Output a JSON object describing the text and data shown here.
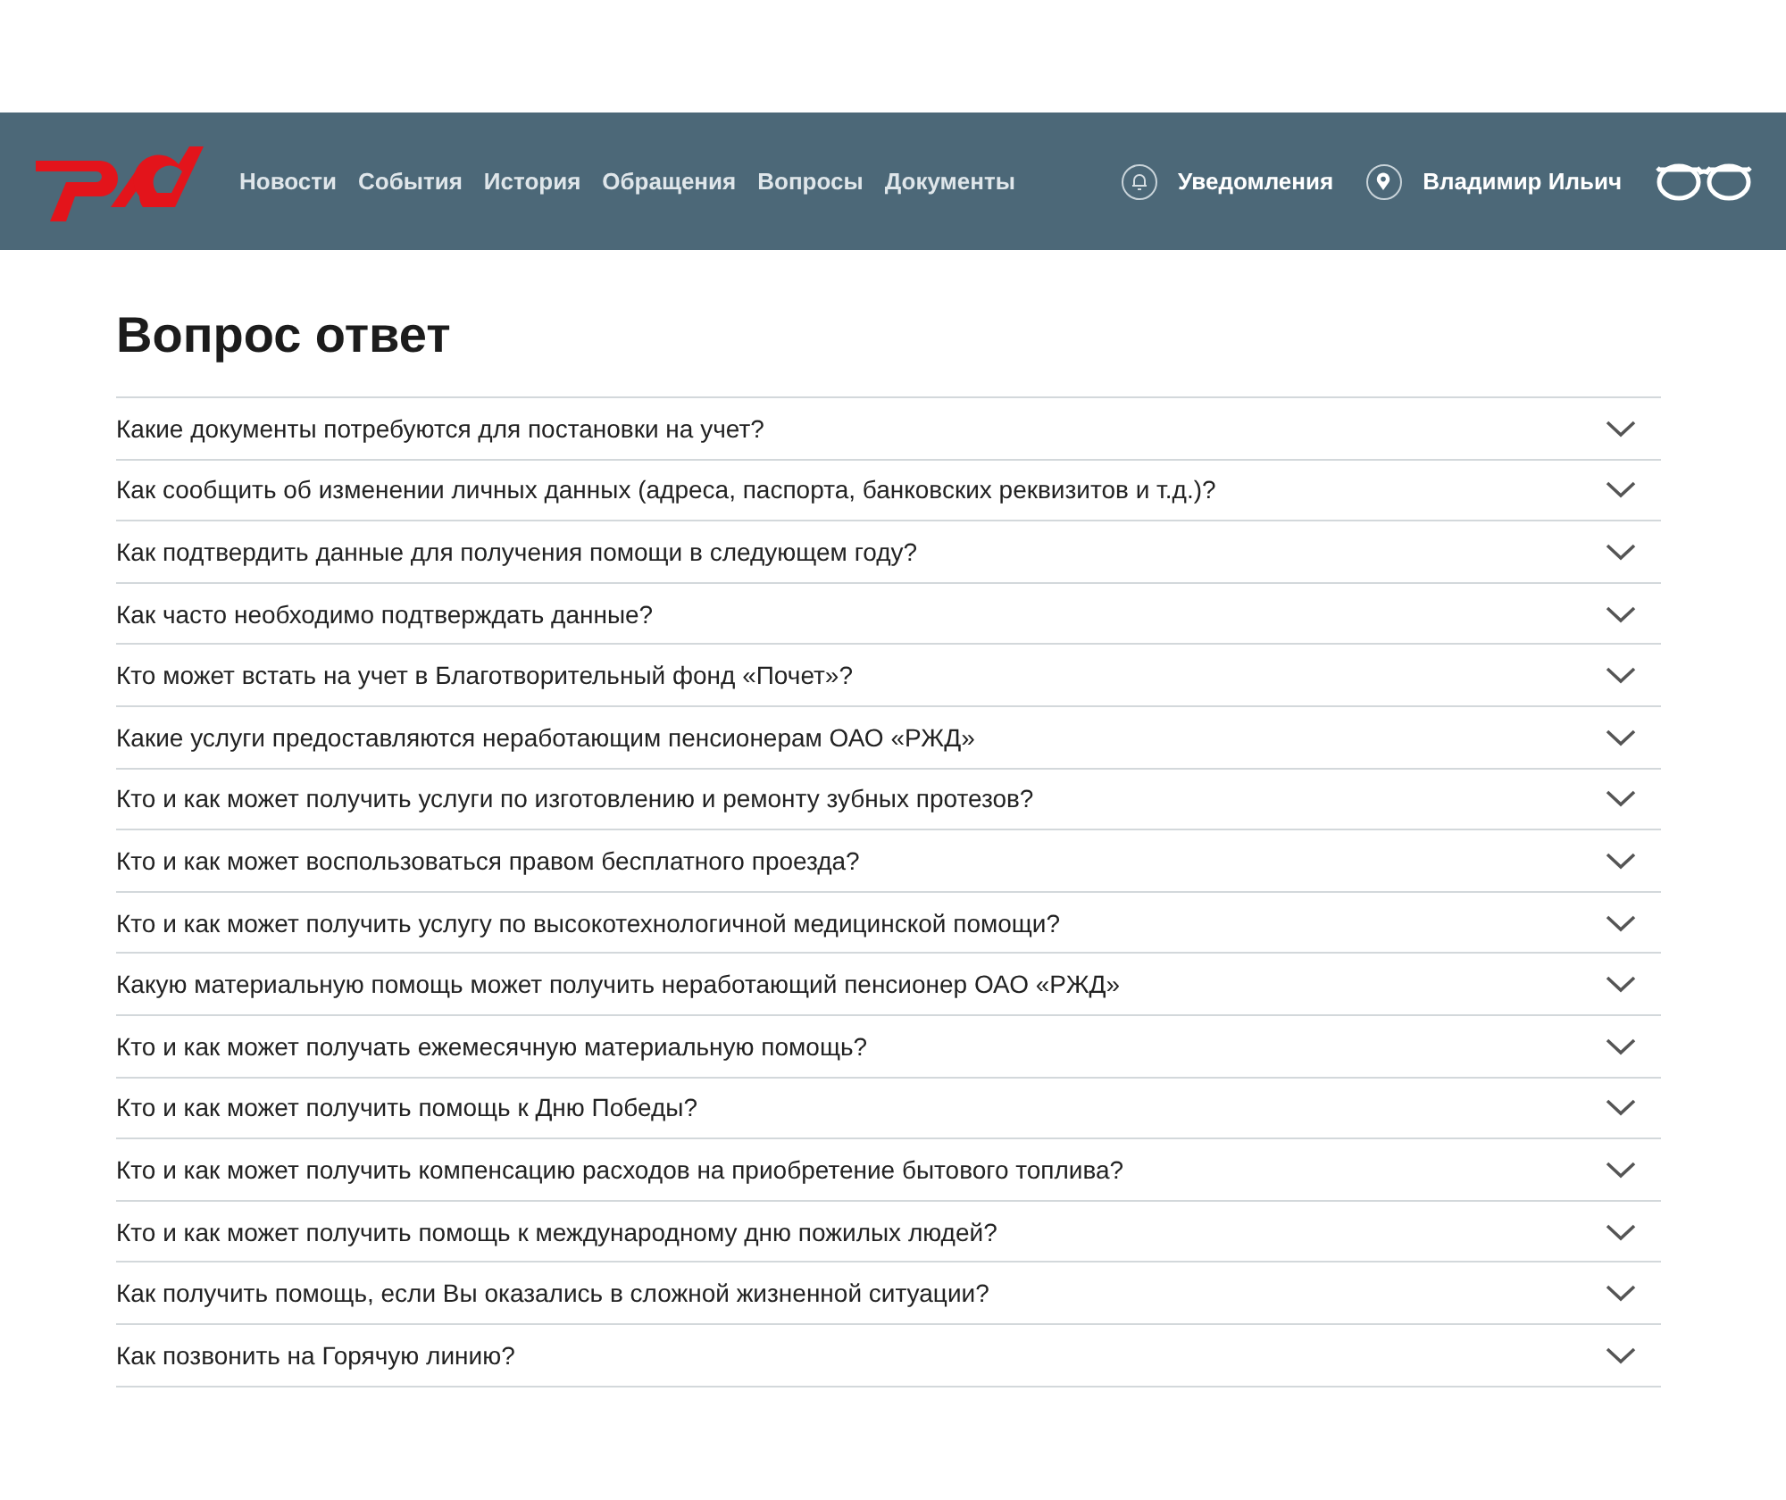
{
  "header": {
    "nav": [
      {
        "label": "Новости"
      },
      {
        "label": "События"
      },
      {
        "label": "История"
      },
      {
        "label": "Обращения"
      },
      {
        "label": "Вопросы"
      },
      {
        "label": "Документы"
      }
    ],
    "notifications": "Уведомления",
    "user": "Владимир Ильич"
  },
  "page_title": "Вопрос ответ",
  "faq": [
    {
      "question": "Какие документы потребуются для постановки на учет?",
      "expanded": false
    },
    {
      "question": "Как сообщить об изменении личных данных (адреса, паспорта, банковских реквизитов и т.д.)?",
      "expanded": false
    },
    {
      "question": "Как подтвердить данные для получения помощи в следующем году?",
      "expanded": false
    },
    {
      "question": "Как часто необходимо подтверждать данные?",
      "expanded": false
    },
    {
      "question": "Кто может встать на учет в Благотворительный фонд «Почет»?",
      "expanded": false
    },
    {
      "question": "Какие услуги предоставляются неработающим пенсионерам ОАО «РЖД»",
      "expanded": false
    },
    {
      "question": "Кто и как может получить услуги по изготовлению и ремонту зубных протезов?",
      "expanded": false
    },
    {
      "question": "Кто и как может воспользоваться правом бесплатного проезда?",
      "expanded": false
    },
    {
      "question": "Кто и как может получить услугу по высокотехнологичной медицинской помощи?",
      "expanded": false
    },
    {
      "question": "Какую материальную помощь может получить неработающий пенсионер ОАО «РЖД»",
      "expanded": false
    },
    {
      "question": "Кто и как может получать ежемесячную материальную помощь?",
      "expanded": false
    },
    {
      "question": "Кто и как может получить помощь к Дню Победы?",
      "expanded": false
    },
    {
      "question": "Кто и как может получить компенсацию расходов на приобретение бытового топлива?",
      "expanded": false
    },
    {
      "question": "Кто и как может получить помощь к международному дню пожилых людей?",
      "expanded": false
    },
    {
      "question": "Как получить помощь, если Вы оказались в сложной жизненной ситуации?",
      "expanded": false
    },
    {
      "question": "Как позвонить на Горячую линию?",
      "expanded": false
    }
  ]
}
